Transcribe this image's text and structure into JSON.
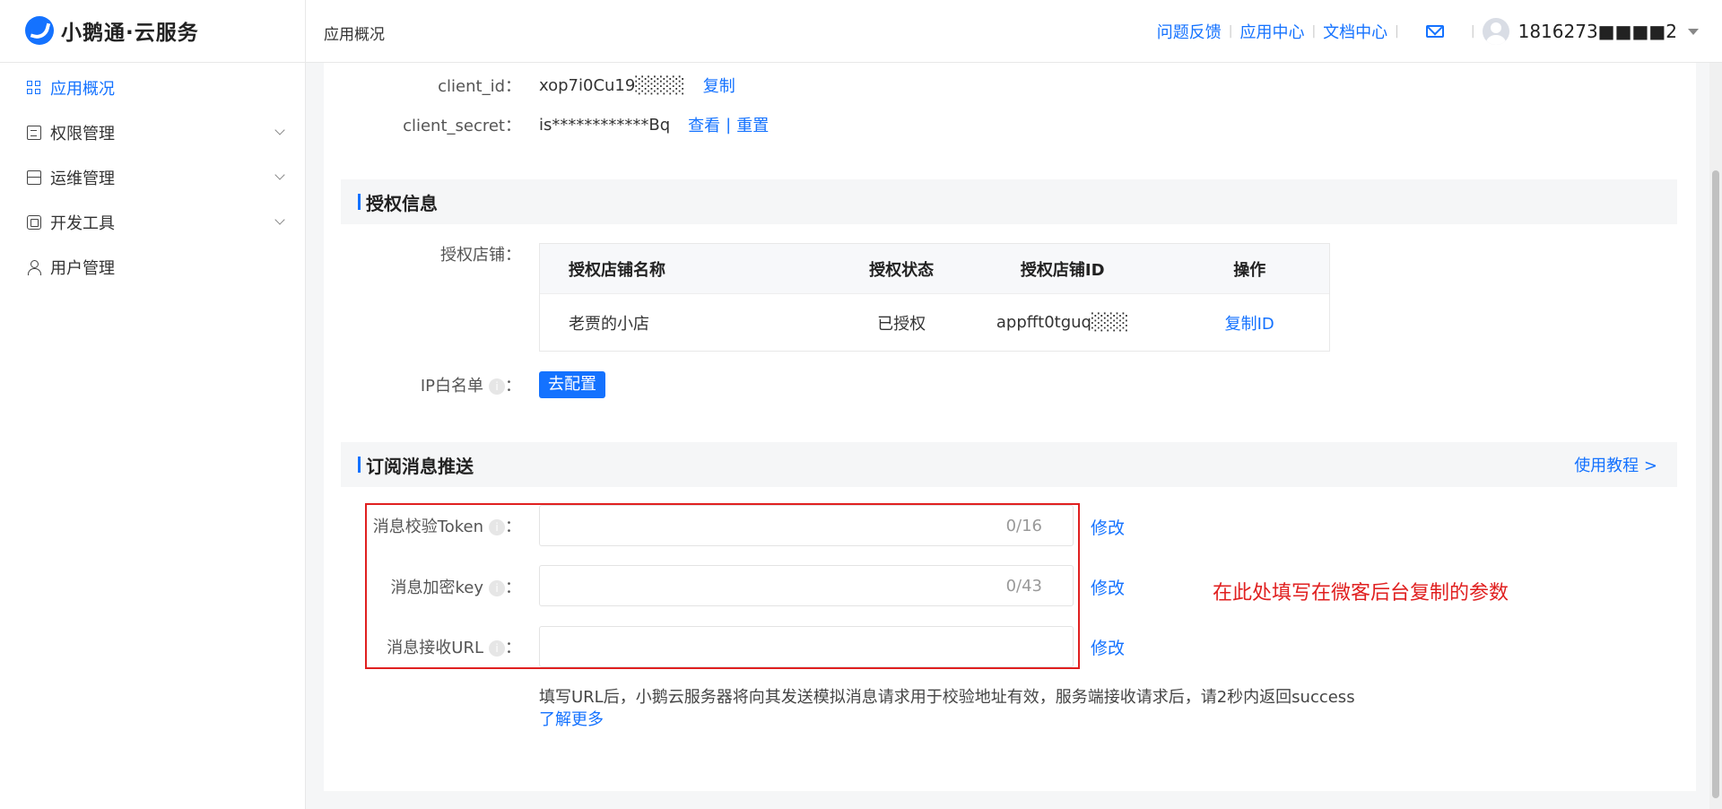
{
  "header": {
    "brand": "小鹅通·云服务",
    "page": "应用概况",
    "links": [
      "问题反馈",
      "应用中心",
      "文档中心"
    ],
    "user": "1816273■■■■2"
  },
  "sidebar": {
    "items": [
      {
        "label": "应用概况",
        "icon": "grid-icon",
        "active": true
      },
      {
        "label": "权限管理",
        "icon": "document-icon"
      },
      {
        "label": "运维管理",
        "icon": "server-icon"
      },
      {
        "label": "开发工具",
        "icon": "toolbox-icon"
      },
      {
        "label": "用户管理",
        "icon": "user-icon"
      }
    ]
  },
  "app_info": {
    "client_id_label": "client_id：",
    "client_id": "xop7i0Cu19░░░░",
    "copy": "复制",
    "client_secret_label": "client_secret：",
    "client_secret": "is************Bq",
    "view": "查看",
    "divider": "|",
    "reset": "重置"
  },
  "auth": {
    "title": "授权信息",
    "shop_label": "授权店铺：",
    "columns": [
      "授权店铺名称",
      "授权状态",
      "授权店铺ID",
      "操作"
    ],
    "rows": [
      {
        "name": "老贾的小店",
        "status": "已授权",
        "id": "appfft0tguq░░░",
        "action": "复制ID"
      }
    ],
    "ip_label": "IP白名单",
    "ip_colon": "：",
    "ip_button": "去配置"
  },
  "push": {
    "title": "订阅消息推送",
    "tutorial": "使用教程 >",
    "colon": "：",
    "fields": [
      {
        "label": "消息校验Token",
        "counter": "0/16",
        "value": "",
        "action": "修改"
      },
      {
        "label": "消息加密key",
        "counter": "0/43",
        "value": "",
        "action": "修改"
      },
      {
        "label": "消息接收URL",
        "counter": "",
        "value": "",
        "action": "修改"
      }
    ],
    "tip": "填写URL后，小鹅云服务器将向其发送模拟消息请求用于校验地址有效，服务端接收请求后，请2秒内返回success",
    "learn_more": "了解更多",
    "annotation": "在此处填写在微客后台复制的参数"
  },
  "colors": {
    "accent": "#1472ff",
    "annotation": "#e02020"
  }
}
